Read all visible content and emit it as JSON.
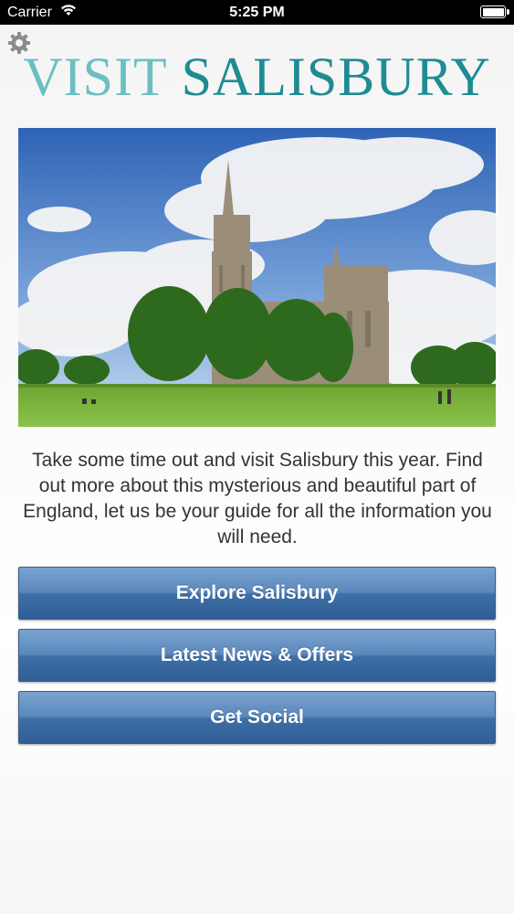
{
  "status_bar": {
    "carrier": "Carrier",
    "time": "5:25 PM"
  },
  "header": {
    "logo_word1": "VISIT",
    "logo_word2": "SALISBURY",
    "settings_icon": "gear-icon"
  },
  "hero": {
    "image": "salisbury-cathedral-photo"
  },
  "intro_text": "Take some time out and visit Salisbury this year. Find out more about this mysterious and beautiful part of England, let us be your guide for all the information you will need.",
  "buttons": [
    {
      "label": "Explore Salisbury"
    },
    {
      "label": "Latest News & Offers"
    },
    {
      "label": "Get Social"
    }
  ],
  "colors": {
    "logo_light": "#6cbfc1",
    "logo_dark": "#1e8c92",
    "button_blue": "#3f6fa7"
  }
}
